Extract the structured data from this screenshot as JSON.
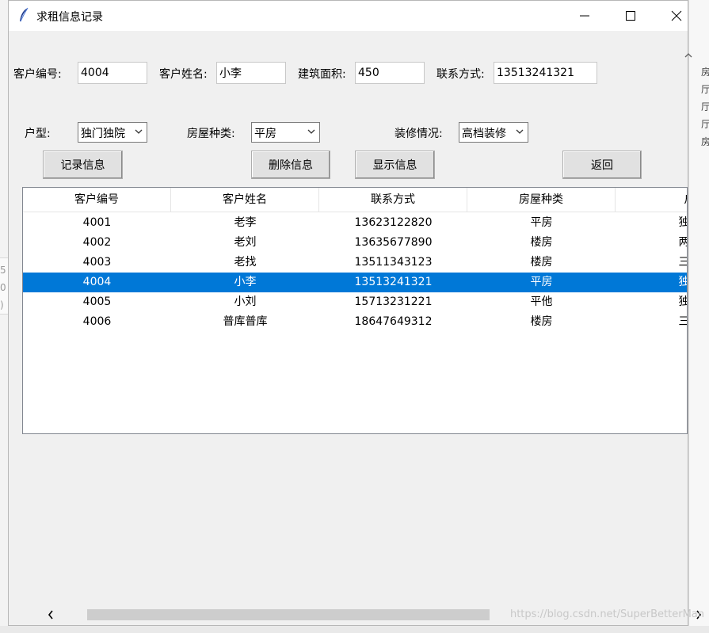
{
  "window": {
    "title": "求租信息记录"
  },
  "form": {
    "customer_id": {
      "label": "客户编号:",
      "value": "4004"
    },
    "customer_name": {
      "label": "客户姓名:",
      "value": "小李"
    },
    "building_area": {
      "label": "建筑面积:",
      "value": "450"
    },
    "contact": {
      "label": "联系方式:",
      "value": "13513241321"
    },
    "house_layout": {
      "label": "户型:",
      "value": "独门独院"
    },
    "house_type": {
      "label": "房屋种类:",
      "value": "平房"
    },
    "decoration": {
      "label": "装修情况:",
      "value": "高档装修"
    }
  },
  "buttons": {
    "record": "记录信息",
    "delete": "删除信息",
    "show": "显示信息",
    "back": "返回"
  },
  "table": {
    "columns": [
      "客户编号",
      "客户姓名",
      "联系方式",
      "房屋种类",
      "户"
    ],
    "rows": [
      [
        "4001",
        "老李",
        "13623122820",
        "平房",
        "独门"
      ],
      [
        "4002",
        "老刘",
        "13635677890",
        "楼房",
        "两室"
      ],
      [
        "4003",
        "老找",
        "13511343123",
        "楼房",
        "三室"
      ],
      [
        "4004",
        "小李",
        "13513241321",
        "平房",
        "独门"
      ],
      [
        "4005",
        "小刘",
        "15713231221",
        "平他",
        "独门"
      ],
      [
        "4006",
        "普库普库",
        "18647649312",
        "楼房",
        "三室"
      ]
    ],
    "selected_index": 3
  },
  "watermark": "https://blog.csdn.net/SuperBetterMan",
  "background": {
    "right_fragments": [
      "房",
      "厅",
      "厅",
      "厅",
      "房"
    ],
    "left_fragments": [
      "5",
      "0",
      ")"
    ]
  },
  "colors": {
    "selection": "#0078d7",
    "window_bg": "#f0f0f0"
  }
}
